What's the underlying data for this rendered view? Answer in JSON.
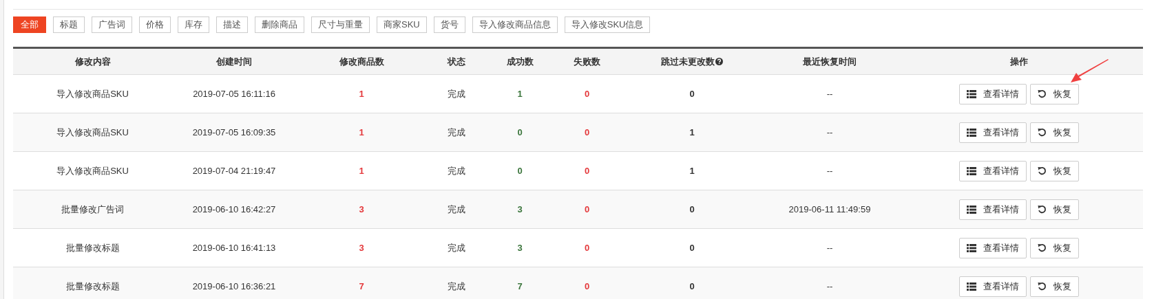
{
  "filters": [
    {
      "label": "全部",
      "selected": true
    },
    {
      "label": "标题",
      "selected": false
    },
    {
      "label": "广告词",
      "selected": false
    },
    {
      "label": "价格",
      "selected": false
    },
    {
      "label": "库存",
      "selected": false
    },
    {
      "label": "描述",
      "selected": false
    },
    {
      "label": "删除商品",
      "selected": false
    },
    {
      "label": "尺寸与重量",
      "selected": false
    },
    {
      "label": "商家SKU",
      "selected": false
    },
    {
      "label": "货号",
      "selected": false
    },
    {
      "label": "导入修改商品信息",
      "selected": false
    },
    {
      "label": "导入修改SKU信息",
      "selected": false
    }
  ],
  "table": {
    "columns": [
      {
        "label": "修改内容",
        "help": false
      },
      {
        "label": "创建时间",
        "help": false
      },
      {
        "label": "修改商品数",
        "help": false
      },
      {
        "label": "状态",
        "help": false
      },
      {
        "label": "成功数",
        "help": false
      },
      {
        "label": "失败数",
        "help": false
      },
      {
        "label": "跳过未更改数",
        "help": true
      },
      {
        "label": "最近恢复时间",
        "help": false
      },
      {
        "label": "操作",
        "help": false
      }
    ],
    "rows": [
      {
        "content": "导入修改商品SKU",
        "created": "2019-07-05 16:11:16",
        "count": "1",
        "status": "完成",
        "success": "1",
        "failed": "0",
        "skipped": "0",
        "restored": "--",
        "details": "查看详情",
        "restore": "恢复",
        "annotated": true
      },
      {
        "content": "导入修改商品SKU",
        "created": "2019-07-05 16:09:35",
        "count": "1",
        "status": "完成",
        "success": "0",
        "failed": "0",
        "skipped": "1",
        "restored": "--",
        "details": "查看详情",
        "restore": "恢复",
        "annotated": false
      },
      {
        "content": "导入修改商品SKU",
        "created": "2019-07-04 21:19:47",
        "count": "1",
        "status": "完成",
        "success": "0",
        "failed": "0",
        "skipped": "1",
        "restored": "--",
        "details": "查看详情",
        "restore": "恢复",
        "annotated": false
      },
      {
        "content": "批量修改广告词",
        "created": "2019-06-10 16:42:27",
        "count": "3",
        "status": "完成",
        "success": "3",
        "failed": "0",
        "skipped": "0",
        "restored": "2019-06-11 11:49:59",
        "details": "查看详情",
        "restore": "恢复",
        "annotated": false
      },
      {
        "content": "批量修改标题",
        "created": "2019-06-10 16:41:13",
        "count": "3",
        "status": "完成",
        "success": "3",
        "failed": "0",
        "skipped": "0",
        "restored": "--",
        "details": "查看详情",
        "restore": "恢复",
        "annotated": false
      },
      {
        "content": "批量修改标题",
        "created": "2019-06-10 16:36:21",
        "count": "7",
        "status": "完成",
        "success": "7",
        "failed": "0",
        "skipped": "0",
        "restored": "--",
        "details": "查看详情",
        "restore": "恢复",
        "annotated": false
      }
    ]
  }
}
